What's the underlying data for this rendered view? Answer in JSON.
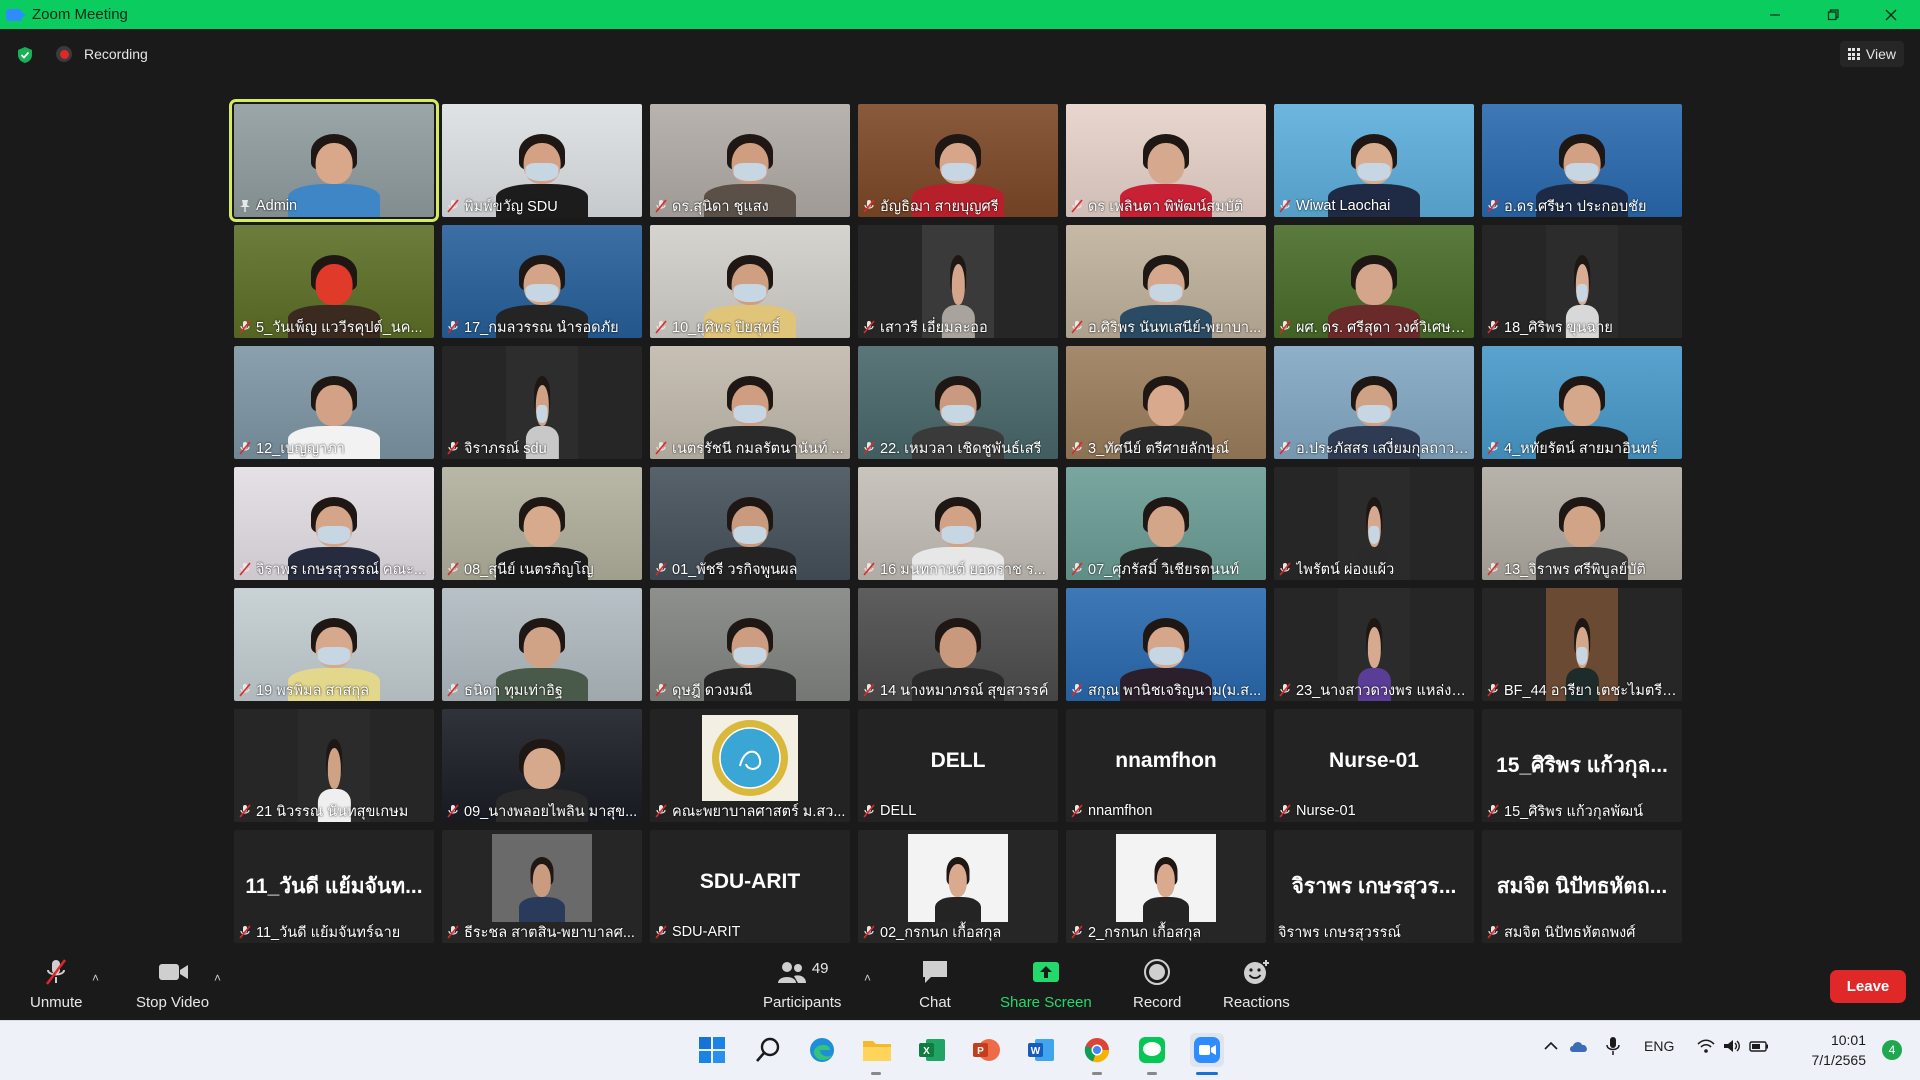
{
  "window": {
    "title": "Zoom Meeting"
  },
  "topbar": {
    "recording_label": "Recording",
    "view_label": "View"
  },
  "participants": [
    {
      "name": "Admin",
      "type": "video",
      "bg": "#9aa6a8",
      "skin": "#d9a88b",
      "shirt": "#3f86c6",
      "mask": false,
      "active": true,
      "pinned": true
    },
    {
      "name": "พิมพ์ขวัญ SDU",
      "type": "video",
      "bg": "#dfe3e6",
      "skin": "#d4a185",
      "shirt": "#1c1c1c",
      "mask": true
    },
    {
      "name": "ดร.สุนิดา ชูแสง",
      "type": "video",
      "bg": "#b8b3ae",
      "skin": "#cf9d80",
      "shirt": "#5a5048",
      "mask": true
    },
    {
      "name": "อัญธิฌา สายบุญศรี",
      "type": "video",
      "bg": "#8a5a3c",
      "skin": "#d7a68a",
      "shirt": "#b7202a",
      "mask": true
    },
    {
      "name": "ดร เพลินตา พิพัฒน์สมบัติ",
      "type": "video",
      "bg": "#e8d6cf",
      "skin": "#d6a98e",
      "shirt": "#c82135",
      "mask": false
    },
    {
      "name": "Wiwat Laochai",
      "type": "video",
      "bg": "#6cb6df",
      "skin": "#d9ac90",
      "shirt": "#1f2a44",
      "mask": true
    },
    {
      "name": "อ.ดร.ศรีษา ประกอบชัย",
      "type": "video",
      "bg": "#3f78b6",
      "skin": "#d2a183",
      "shirt": "#1c2a45",
      "mask": true
    },
    {
      "name": "5_วันเพ็ญ แววีรคุปต์_นค...",
      "type": "video",
      "bg": "#6d7d3c",
      "skin": "#e03a2a",
      "shirt": "#3a2a20",
      "mask": false
    },
    {
      "name": "17_กมลวรรณ นำรอดภัย",
      "type": "video",
      "bg": "#3c6fa4",
      "skin": "#d3a487",
      "shirt": "#242424",
      "mask": true
    },
    {
      "name": "10_ยุศิพร ปิยสุทธิ์",
      "type": "video",
      "bg": "#d6d4cf",
      "skin": "#cf9f82",
      "shirt": "#e0c47a",
      "mask": true
    },
    {
      "name": "เสาวรี เอี่ยมละออ",
      "type": "video",
      "bg": "#3a3a3a",
      "skin": "#d4a58a",
      "shirt": "#a8a39c",
      "mask": false,
      "narrow": true
    },
    {
      "name": "อ.ศิริพร นันทเสนีย์-พยาบา...",
      "type": "video",
      "bg": "#c6b9a6",
      "skin": "#d5a78c",
      "shirt": "#2a4b63",
      "mask": true
    },
    {
      "name": "ผศ. ดร. ศรีสุดา วงศ์วิเศษกุ...",
      "type": "video",
      "bg": "#5a7a3e",
      "skin": "#d4a58a",
      "shirt": "#6b2a2a",
      "mask": false
    },
    {
      "name": "18_ศิริพร ขุนฉาย",
      "type": "video",
      "bg": "#2c2c2c",
      "skin": "#d8ad93",
      "shirt": "#d8d8d8",
      "mask": true,
      "narrow": true
    },
    {
      "name": "12_เบญญาภา",
      "type": "video",
      "bg": "#8aa0ad",
      "skin": "#d3a286",
      "shirt": "#f2f2f2",
      "mask": false
    },
    {
      "name": "จิราภรณ์ sdu",
      "type": "video",
      "bg": "#2d2d2d",
      "skin": "#d1a184",
      "shirt": "#c8c8c8",
      "mask": true,
      "narrow": true
    },
    {
      "name": "เนตรรัชนี กมลรัตนานันท์ ...",
      "type": "video",
      "bg": "#c7c0b4",
      "skin": "#cf9e80",
      "shirt": "#2a2a2a",
      "mask": true
    },
    {
      "name": "22. เหมวลา เชิดชูพันธ์เสรี",
      "type": "video",
      "bg": "#5a7678",
      "skin": "#c99a80",
      "shirt": "#3a3a3a",
      "mask": true
    },
    {
      "name": "3_ทัศนีย์ ตรีศายลักษณ์",
      "type": "video",
      "bg": "#a58a6c",
      "skin": "#d8a98c",
      "shirt": "#2a2a2a",
      "mask": false
    },
    {
      "name": "อ.ประภัสสร เสงี่ยมกุลถาวร ...",
      "type": "video",
      "bg": "#8fb0c9",
      "skin": "#d0a285",
      "shirt": "#2e3b52",
      "mask": true
    },
    {
      "name": "4_หทัยรัตน์ สายมาอินทร์",
      "type": "video",
      "bg": "#5aa3cf",
      "skin": "#d6a88b",
      "shirt": "#1e1e1e",
      "mask": false
    },
    {
      "name": "จิราพร เกษรสุวรรณ์ คณะ...",
      "type": "video",
      "bg": "#e6e1e6",
      "skin": "#d4a589",
      "shirt": "#262b3d",
      "mask": true
    },
    {
      "name": "08_สุนีย์ เนตรภิญโญ",
      "type": "video",
      "bg": "#b9b8a7",
      "skin": "#d7a98d",
      "shirt": "#1c1c1c",
      "mask": false
    },
    {
      "name": "01_พัชรี วรกิจพูนผล",
      "type": "video",
      "bg": "#58626b",
      "skin": "#c99a7e",
      "shirt": "#232323",
      "mask": true
    },
    {
      "name": "16 มนทกานต์ ยอดราช ร...",
      "type": "video",
      "bg": "#c9c4bd",
      "skin": "#d1a285",
      "shirt": "#e7e7e7",
      "mask": true
    },
    {
      "name": "07_ศุภรัสมิ์ วิเชียรตนนท์",
      "type": "video",
      "bg": "#79a7a0",
      "skin": "#d3a589",
      "shirt": "#222222",
      "mask": false
    },
    {
      "name": "ไพรัตน์ ผ่องแผ้ว",
      "type": "video",
      "bg": "#2b2b2b",
      "skin": "#d6a98e",
      "shirt": "#2a2a2a",
      "mask": true,
      "narrow": true
    },
    {
      "name": "13_จิราพร ศรีพิบูลย์บัติ",
      "type": "video",
      "bg": "#b7b3ab",
      "skin": "#d1a387",
      "shirt": "#3a3a3a",
      "mask": false
    },
    {
      "name": "19 พรพิมล สาสกุล",
      "type": "video",
      "bg": "#c9d3d6",
      "skin": "#d6a98d",
      "shirt": "#e3d78c",
      "mask": true
    },
    {
      "name": "ธนิดา ทุมเท่าอิฐ",
      "type": "video",
      "bg": "#b8c1c6",
      "skin": "#d1a386",
      "shirt": "#4a5a4a",
      "mask": false
    },
    {
      "name": "ดุษฎี ดวงมณี",
      "type": "video",
      "bg": "#8d908c",
      "skin": "#cd9d81",
      "shirt": "#262626",
      "mask": true
    },
    {
      "name": "14 นางหมาภรณ์ สุขสวรรค์",
      "type": "video",
      "bg": "#5e5e5e",
      "skin": "#c9997d",
      "shirt": "#2b2b2b",
      "mask": false
    },
    {
      "name": "สกุณ พานิชเจริญนาม(ม.ส...",
      "type": "video",
      "bg": "#3f78b6",
      "skin": "#d5a68a",
      "shirt": "#2a1f2a",
      "mask": true
    },
    {
      "name": "23_นางสาวดวงพร แหล่งห...",
      "type": "video",
      "bg": "#2b2b2b",
      "skin": "#d7aa8f",
      "shirt": "#5a3d96",
      "mask": false,
      "narrow": true
    },
    {
      "name": "BF_44 อารียา เตชะไมตรีจิ...",
      "type": "video",
      "bg": "#6a4a33",
      "skin": "#d4a68a",
      "shirt": "#1e2b2b",
      "mask": true,
      "narrow": true
    },
    {
      "name": "21 นิวรรณ นันทสุขเกษม",
      "type": "video",
      "bg": "#2b2b2b",
      "skin": "#d0a285",
      "shirt": "#efefef",
      "mask": false,
      "narrow": true
    },
    {
      "name": "09_นางพลอยไพลิน มาสุข...",
      "type": "video",
      "bg": "#30333a",
      "skin": "#d6a88c",
      "shirt": "#2a2a2a",
      "mask": false
    },
    {
      "name": "คณะพยาบาลศาสตร์ ม.สว...",
      "type": "logo"
    },
    {
      "name": "DELL",
      "type": "text",
      "big": "DELL"
    },
    {
      "name": "nnamfhon",
      "type": "text",
      "big": "nnamfhon"
    },
    {
      "name": "Nurse-01",
      "type": "text",
      "big": "Nurse-01"
    },
    {
      "name": "15_ศิริพร แก้วกุลพัฒน์",
      "type": "text",
      "big": "15_ศิริพร แก้วกุล..."
    },
    {
      "name": "11_วันดี แย้มจันทร์ฉาย",
      "type": "text",
      "big": "11_วันดี แย้มจันท..."
    },
    {
      "name": "ธีระชล สาตสิน-พยาบาลศ...",
      "type": "photo",
      "bg": "#6a6a6a",
      "skin": "#c99b7f",
      "shirt": "#2a3a5a"
    },
    {
      "name": "SDU-ARIT",
      "type": "text",
      "big": "SDU-ARIT"
    },
    {
      "name": "02_กรกนก เกื้อสกุล",
      "type": "photo",
      "bg": "#f3f3f3",
      "skin": "#d9aa8e",
      "shirt": "#242424"
    },
    {
      "name": "2_กรกนก เกื้อสกุล",
      "type": "photo",
      "bg": "#f3f3f3",
      "skin": "#d9aa8e",
      "shirt": "#242424"
    },
    {
      "name": "จิราพร เกษรสุวรรณ์",
      "type": "text",
      "big": "จิราพร เกษรสุวร...",
      "nomute": true
    },
    {
      "name": "สมจิต นิปัทธหัตถพงศ์",
      "type": "text",
      "big": "สมจิต นิปัทธหัตถ..."
    }
  ],
  "toolbar": {
    "unmute": "Unmute",
    "stop_video": "Stop Video",
    "participants": "Participants",
    "participants_count": "49",
    "chat": "Chat",
    "share_screen": "Share Screen",
    "record": "Record",
    "reactions": "Reactions",
    "leave": "Leave"
  },
  "taskbar": {
    "apps": [
      "start-icon",
      "search-icon",
      "edge-icon",
      "file-explorer-icon",
      "excel-icon",
      "powerpoint-icon",
      "word-icon",
      "chrome-icon",
      "line-icon",
      "zoom-icon"
    ],
    "language": "ENG",
    "time": "10:01",
    "date": "7/1/2565",
    "notifications": "4"
  },
  "colors": {
    "titlebar": "#0bcd5f",
    "active_speaker_outline": "#d5ec61",
    "mute_red": "#e02828",
    "share_green": "#23d96b",
    "leave_red": "#e02828"
  }
}
